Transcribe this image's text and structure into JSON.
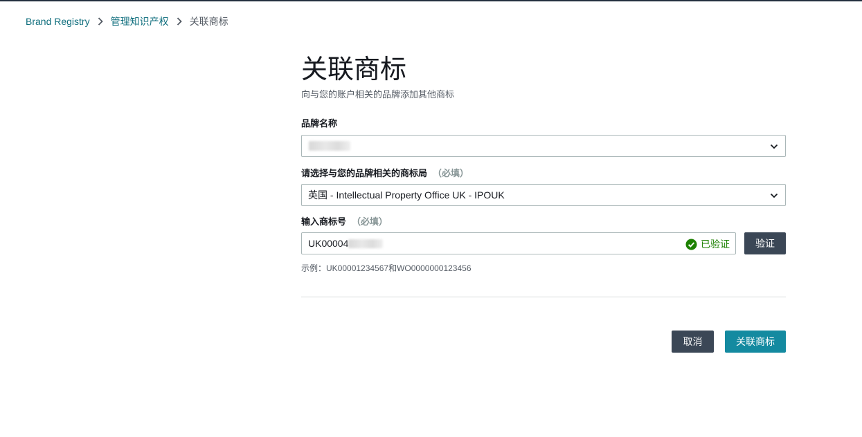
{
  "breadcrumb": {
    "items": [
      {
        "label": "Brand Registry"
      },
      {
        "label": "管理知识产权"
      },
      {
        "label": "关联商标"
      }
    ]
  },
  "page": {
    "title": "关联商标",
    "subtitle": "向与您的账户相关的品牌添加其他商标"
  },
  "form": {
    "brand_name": {
      "label": "品牌名称",
      "value": ""
    },
    "trademark_office": {
      "label": "请选择与您的品牌相关的商标局",
      "required_tag": "（必填）",
      "value": "英国 - Intellectual Property Office UK - IPOUK"
    },
    "trademark_number": {
      "label": "输入商标号",
      "required_tag": "（必填）",
      "value": "UK00004",
      "status": "已验证",
      "verify_button": "验证",
      "hint": "示例：UK00001234567和WO0000000123456"
    }
  },
  "actions": {
    "cancel": "取消",
    "submit": "关联商标"
  },
  "colors": {
    "link": "#0f6e7d",
    "primary": "#148aa0",
    "dark_button": "#3b4756",
    "verified": "#1d8102"
  },
  "icons": {
    "breadcrumb_separator": "chevron-right-icon",
    "select_arrow": "chevron-down-icon",
    "verified": "check-circle-icon"
  }
}
